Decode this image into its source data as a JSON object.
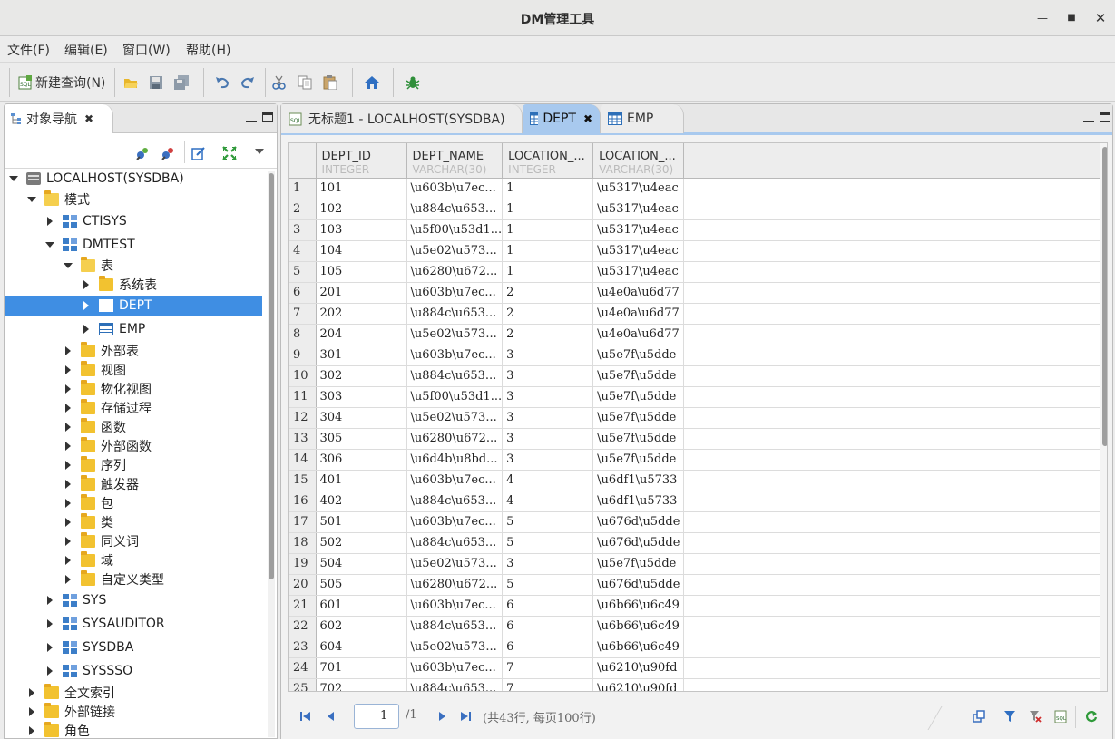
{
  "window": {
    "title": "DM管理工具"
  },
  "menu": [
    "文件(F)",
    "编辑(E)",
    "窗口(W)",
    "帮助(H)"
  ],
  "toolbar": {
    "new_query_label": "新建查询(N)"
  },
  "left_panel": {
    "tab_label": "对象导航",
    "tree": [
      {
        "label": "LOCALHOST(SYSDBA)",
        "icon": "server-icon",
        "level": 0,
        "state": "expanded"
      },
      {
        "label": "模式",
        "icon": "folder-open-icon",
        "level": 1,
        "state": "expanded"
      },
      {
        "label": "CTISYS",
        "icon": "schema-icon",
        "level": 2,
        "state": "collapsed"
      },
      {
        "label": "DMTEST",
        "icon": "schema-icon",
        "level": 2,
        "state": "expanded"
      },
      {
        "label": "表",
        "icon": "folder-open-icon",
        "level": 3,
        "state": "expanded"
      },
      {
        "label": "系统表",
        "icon": "folder-icon",
        "level": 4,
        "state": "collapsed"
      },
      {
        "label": "DEPT",
        "icon": "table-icon",
        "level": 4,
        "state": "collapsed",
        "selected": true
      },
      {
        "label": "EMP",
        "icon": "table-icon",
        "level": 4,
        "state": "collapsed"
      },
      {
        "label": "外部表",
        "icon": "folder-icon",
        "level": 3,
        "state": "collapsed"
      },
      {
        "label": "视图",
        "icon": "folder-icon",
        "level": 3,
        "state": "collapsed"
      },
      {
        "label": "物化视图",
        "icon": "folder-icon",
        "level": 3,
        "state": "collapsed"
      },
      {
        "label": "存储过程",
        "icon": "folder-icon",
        "level": 3,
        "state": "collapsed"
      },
      {
        "label": "函数",
        "icon": "folder-icon",
        "level": 3,
        "state": "collapsed"
      },
      {
        "label": "外部函数",
        "icon": "folder-icon",
        "level": 3,
        "state": "collapsed"
      },
      {
        "label": "序列",
        "icon": "folder-icon",
        "level": 3,
        "state": "collapsed"
      },
      {
        "label": "触发器",
        "icon": "folder-icon",
        "level": 3,
        "state": "collapsed"
      },
      {
        "label": "包",
        "icon": "folder-icon",
        "level": 3,
        "state": "collapsed"
      },
      {
        "label": "类",
        "icon": "folder-icon",
        "level": 3,
        "state": "collapsed"
      },
      {
        "label": "同义词",
        "icon": "folder-icon",
        "level": 3,
        "state": "collapsed"
      },
      {
        "label": "域",
        "icon": "folder-icon",
        "level": 3,
        "state": "collapsed"
      },
      {
        "label": "自定义类型",
        "icon": "folder-icon",
        "level": 3,
        "state": "collapsed"
      },
      {
        "label": "SYS",
        "icon": "schema-icon",
        "level": 2,
        "state": "collapsed"
      },
      {
        "label": "SYSAUDITOR",
        "icon": "schema-icon",
        "level": 2,
        "state": "collapsed"
      },
      {
        "label": "SYSDBA",
        "icon": "schema-icon",
        "level": 2,
        "state": "collapsed"
      },
      {
        "label": "SYSSSO",
        "icon": "schema-icon",
        "level": 2,
        "state": "collapsed"
      },
      {
        "label": "全文索引",
        "icon": "folder-icon",
        "level": 1,
        "state": "collapsed"
      },
      {
        "label": "外部链接",
        "icon": "folder-icon",
        "level": 1,
        "state": "collapsed"
      },
      {
        "label": "角色",
        "icon": "folder-icon",
        "level": 1,
        "state": "collapsed"
      }
    ]
  },
  "editor_tabs": [
    {
      "label": "无标题1 - LOCALHOST(SYSDBA)",
      "icon": "sql-file-icon",
      "active": false
    },
    {
      "label": "DEPT",
      "icon": "table-icon",
      "active": true,
      "closable": true
    },
    {
      "label": "EMP",
      "icon": "table-icon",
      "active": false
    }
  ],
  "grid": {
    "columns": [
      {
        "name": "DEPT_ID",
        "type": "INTEGER"
      },
      {
        "name": "DEPT_NAME",
        "type": "VARCHAR(30)"
      },
      {
        "name": "LOCATION_...",
        "type": "INTEGER"
      },
      {
        "name": "LOCATION_...",
        "type": "VARCHAR(30)"
      }
    ],
    "rows": [
      [
        "1",
        "101",
        "\\u603b\\u7ec...",
        "1",
        "\\u5317\\u4eac"
      ],
      [
        "2",
        "102",
        "\\u884c\\u653...",
        "1",
        "\\u5317\\u4eac"
      ],
      [
        "3",
        "103",
        "\\u5f00\\u53d1...",
        "1",
        "\\u5317\\u4eac"
      ],
      [
        "4",
        "104",
        "\\u5e02\\u573...",
        "1",
        "\\u5317\\u4eac"
      ],
      [
        "5",
        "105",
        "\\u6280\\u672...",
        "1",
        "\\u5317\\u4eac"
      ],
      [
        "6",
        "201",
        "\\u603b\\u7ec...",
        "2",
        "\\u4e0a\\u6d77"
      ],
      [
        "7",
        "202",
        "\\u884c\\u653...",
        "2",
        "\\u4e0a\\u6d77"
      ],
      [
        "8",
        "204",
        "\\u5e02\\u573...",
        "2",
        "\\u4e0a\\u6d77"
      ],
      [
        "9",
        "301",
        "\\u603b\\u7ec...",
        "3",
        "\\u5e7f\\u5dde"
      ],
      [
        "10",
        "302",
        "\\u884c\\u653...",
        "3",
        "\\u5e7f\\u5dde"
      ],
      [
        "11",
        "303",
        "\\u5f00\\u53d1...",
        "3",
        "\\u5e7f\\u5dde"
      ],
      [
        "12",
        "304",
        "\\u5e02\\u573...",
        "3",
        "\\u5e7f\\u5dde"
      ],
      [
        "13",
        "305",
        "\\u6280\\u672...",
        "3",
        "\\u5e7f\\u5dde"
      ],
      [
        "14",
        "306",
        "\\u6d4b\\u8bd...",
        "3",
        "\\u5e7f\\u5dde"
      ],
      [
        "15",
        "401",
        "\\u603b\\u7ec...",
        "4",
        "\\u6df1\\u5733"
      ],
      [
        "16",
        "402",
        "\\u884c\\u653...",
        "4",
        "\\u6df1\\u5733"
      ],
      [
        "17",
        "501",
        "\\u603b\\u7ec...",
        "5",
        "\\u676d\\u5dde"
      ],
      [
        "18",
        "502",
        "\\u884c\\u653...",
        "5",
        "\\u676d\\u5dde"
      ],
      [
        "19",
        "504",
        "\\u5e02\\u573...",
        "3",
        "\\u5e7f\\u5dde"
      ],
      [
        "20",
        "505",
        "\\u6280\\u672...",
        "5",
        "\\u676d\\u5dde"
      ],
      [
        "21",
        "601",
        "\\u603b\\u7ec...",
        "6",
        "\\u6b66\\u6c49"
      ],
      [
        "22",
        "602",
        "\\u884c\\u653...",
        "6",
        "\\u6b66\\u6c49"
      ],
      [
        "23",
        "604",
        "\\u5e02\\u573...",
        "6",
        "\\u6b66\\u6c49"
      ],
      [
        "24",
        "701",
        "\\u603b\\u7ec...",
        "7",
        "\\u6210\\u90fd"
      ],
      [
        "25",
        "702",
        "\\u884c\\u653...",
        "7",
        "\\u6210\\u90fd"
      ]
    ]
  },
  "pager": {
    "page_value": "1",
    "total_pages": "/1",
    "summary": "(共43行, 每页100行)"
  },
  "colors": {
    "selection": "#3f8ee3",
    "active_tab": "#a8c9ee"
  }
}
